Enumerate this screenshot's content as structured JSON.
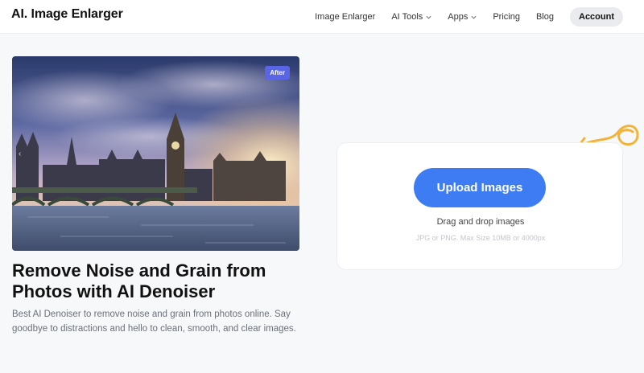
{
  "header": {
    "logo": "AI. Image Enlarger",
    "nav": [
      {
        "label": "Image Enlarger",
        "has_dropdown": false
      },
      {
        "label": "AI Tools",
        "has_dropdown": true
      },
      {
        "label": "Apps",
        "has_dropdown": true
      },
      {
        "label": "Pricing",
        "has_dropdown": false
      },
      {
        "label": "Blog",
        "has_dropdown": false
      }
    ],
    "account_label": "Account"
  },
  "hero": {
    "badge": "After",
    "title": "Remove Noise and Grain from Photos with AI Denoiser",
    "description": "Best AI Denoiser to remove noise and grain from photos online. Say goodbye to distractions and hello to clean, smooth, and clear images."
  },
  "upload": {
    "button_label": "Upload Images",
    "drag_text": "Drag and drop images",
    "hint": "JPG or PNG. Max Size 10MB or 4000px"
  },
  "colors": {
    "accent": "#3d7cf2",
    "badge": "#5a64e6",
    "arrow": "#f2b53a"
  }
}
